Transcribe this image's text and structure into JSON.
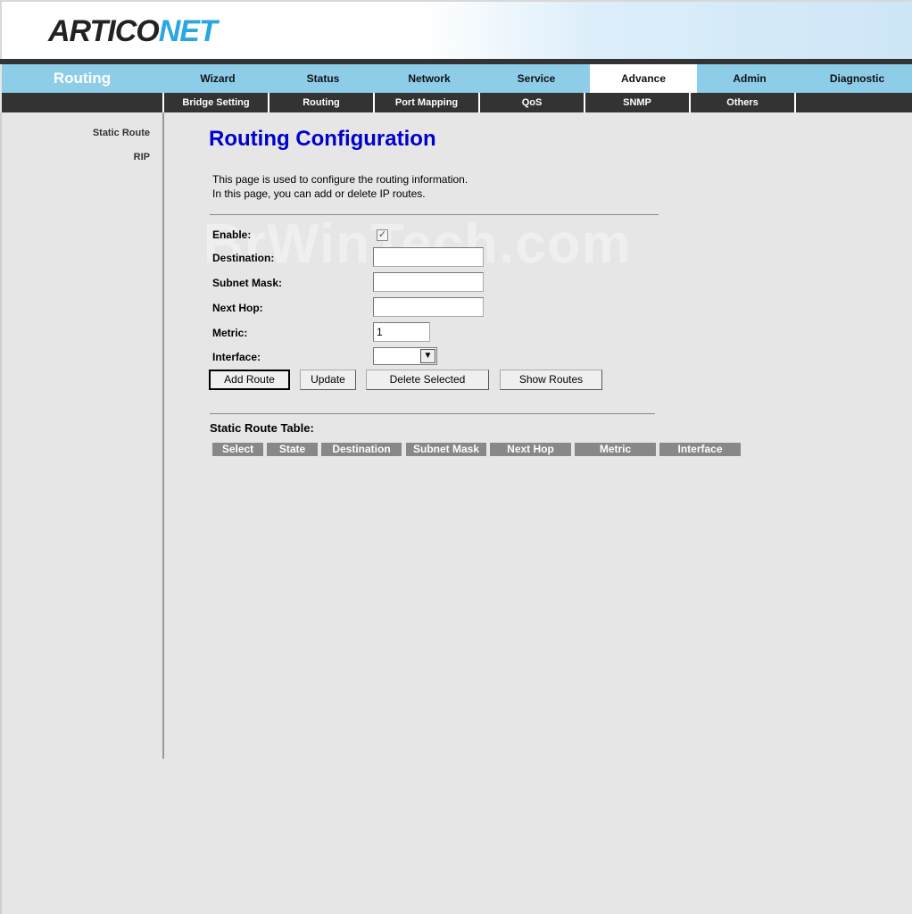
{
  "header": {
    "logo_part1": "ARTICO",
    "logo_part2": "NET"
  },
  "section_title": "Routing",
  "topnav": [
    "Wizard",
    "Status",
    "Network",
    "Service",
    "Advance",
    "Admin",
    "Diagnostic"
  ],
  "topnav_active": "Advance",
  "subnav": [
    "Bridge Setting",
    "Routing",
    "Port Mapping",
    "QoS",
    "SNMP",
    "Others"
  ],
  "sidebar": [
    "Static Route",
    "RIP"
  ],
  "main": {
    "title": "Routing Configuration",
    "desc1": "This page is used to configure the routing information.",
    "desc2": "In this page, you can add or delete IP routes."
  },
  "form": {
    "enable_label": "Enable:",
    "enable_checked": true,
    "destination_label": "Destination:",
    "destination_value": "",
    "subnet_label": "Subnet Mask:",
    "subnet_value": "",
    "nexthop_label": "Next Hop:",
    "nexthop_value": "",
    "metric_label": "Metric:",
    "metric_value": "1",
    "interface_label": "Interface:",
    "interface_value": ""
  },
  "buttons": {
    "add": "Add Route",
    "update": "Update",
    "delete": "Delete Selected",
    "show": "Show Routes"
  },
  "table": {
    "title": "Static Route Table:",
    "headers": [
      "Select",
      "State",
      "Destination",
      "Subnet Mask",
      "Next Hop",
      "Metric",
      "Interface"
    ]
  },
  "watermark": "BrWinTech.com",
  "colors": {
    "title": "#0000cc",
    "nav_bg": "#8ecde8",
    "subnav_bg": "#333333",
    "header_cell": "#888888"
  }
}
